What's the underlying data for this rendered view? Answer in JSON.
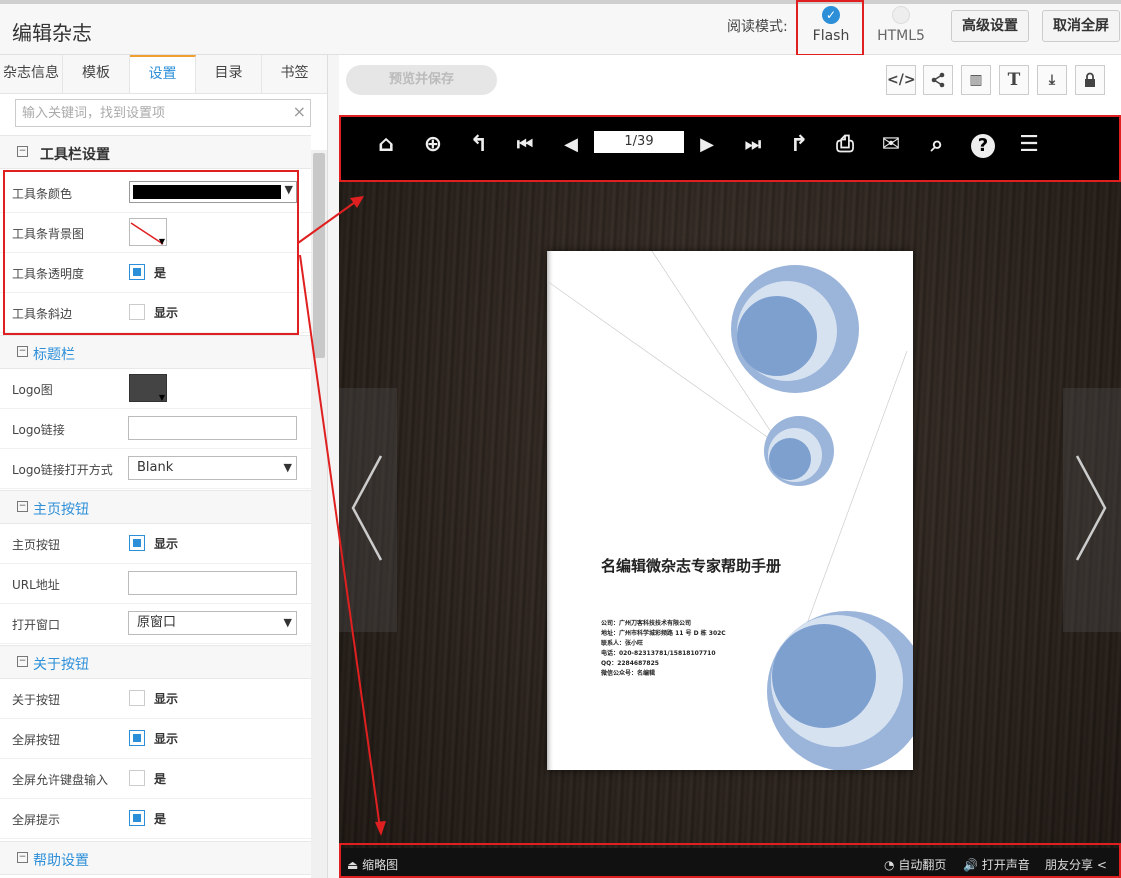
{
  "app": {
    "title": "编辑杂志"
  },
  "header": {
    "mode_label": "阅读模式:",
    "modes": [
      {
        "label": "Flash",
        "selected": true
      },
      {
        "label": "HTML5",
        "selected": false
      }
    ],
    "advanced_button": "高级设置",
    "exit_fullscreen_button": "取消全屏"
  },
  "tabs": [
    {
      "label": "杂志信息"
    },
    {
      "label": "模板"
    },
    {
      "label": "设置",
      "active": true
    },
    {
      "label": "目录"
    },
    {
      "label": "书签"
    }
  ],
  "search": {
    "placeholder": "输入关键词，找到设置项",
    "clear_icon": "×"
  },
  "sections": {
    "toolbar": {
      "title": "工具栏设置",
      "sign": "−"
    },
    "titlebar": {
      "title": "标题栏",
      "sign": "−"
    },
    "home": {
      "title": "主页按钮",
      "sign": "−"
    },
    "about": {
      "title": "关于按钮",
      "sign": "−"
    },
    "help": {
      "title": "帮助设置",
      "sign": "−"
    }
  },
  "settings": {
    "toolbar_color": {
      "label": "工具条颜色",
      "value": "#000000"
    },
    "toolbar_bg": {
      "label": "工具条背景图"
    },
    "toolbar_alpha": {
      "label": "工具条透明度",
      "checked": true,
      "text": "是"
    },
    "toolbar_bevel": {
      "label": "工具条斜边",
      "checked": false,
      "text": "显示"
    },
    "logo_image": {
      "label": "Logo图"
    },
    "logo_link": {
      "label": "Logo链接",
      "value": ""
    },
    "logo_target": {
      "label": "Logo链接打开方式",
      "value": "Blank"
    },
    "home_button": {
      "label": "主页按钮",
      "checked": true,
      "text": "显示"
    },
    "url": {
      "label": "URL地址",
      "value": ""
    },
    "open_window": {
      "label": "打开窗口",
      "value": "原窗口"
    },
    "about_button": {
      "label": "关于按钮",
      "checked": false,
      "text": "显示"
    },
    "fullscreen_button": {
      "label": "全屏按钮",
      "checked": true,
      "text": "显示"
    },
    "fullscreen_keyboard": {
      "label": "全屏允许键盘输入",
      "checked": false,
      "text": "是"
    },
    "fullscreen_tip": {
      "label": "全屏提示",
      "checked": true,
      "text": "是"
    }
  },
  "right": {
    "preview_button": "预览并保存",
    "tools": [
      {
        "icon": "embed-code-icon",
        "glyph": "</>"
      },
      {
        "icon": "share-icon",
        "glyph": "<"
      },
      {
        "icon": "book-icon",
        "glyph": "▥"
      },
      {
        "icon": "text-icon",
        "glyph": "T"
      },
      {
        "icon": "download-icon",
        "glyph": "⤓"
      },
      {
        "icon": "lock-icon",
        "glyph": "🔒"
      }
    ]
  },
  "viewer": {
    "page_field": "1/39",
    "toolbar_icons": [
      {
        "name": "home-icon",
        "glyph": "⌂"
      },
      {
        "name": "zoom-in-icon",
        "glyph": "⊕"
      },
      {
        "name": "back-icon",
        "glyph": "↰"
      },
      {
        "name": "first-page-icon",
        "glyph": "⏮"
      },
      {
        "name": "prev-page-icon",
        "glyph": "◀"
      },
      {
        "name": "next-page-icon",
        "glyph": "▶"
      },
      {
        "name": "last-page-icon",
        "glyph": "⏭"
      },
      {
        "name": "forward-icon",
        "glyph": "↱"
      },
      {
        "name": "print-icon",
        "glyph": "⎙"
      },
      {
        "name": "mail-icon",
        "glyph": "✉"
      },
      {
        "name": "search-icon",
        "glyph": "⌕"
      },
      {
        "name": "help-icon",
        "glyph": "?"
      },
      {
        "name": "menu-icon",
        "glyph": "☰"
      }
    ],
    "page": {
      "title": "名编辑微杂志专家帮助手册",
      "info": [
        "公司：广州刀客科技技术有限公司",
        "地址：广州市科学城彩频路 11 号 D 栋 302C",
        "联系人：张小旺",
        "电话：020-82313781/15818107710",
        "QQ：2284687825",
        "微信公众号：名编辑"
      ]
    },
    "bottombar": {
      "thumbnail": "缩略图",
      "auto_flip": "自动翻页",
      "sound": "打开声音",
      "share": "朋友分享"
    }
  }
}
